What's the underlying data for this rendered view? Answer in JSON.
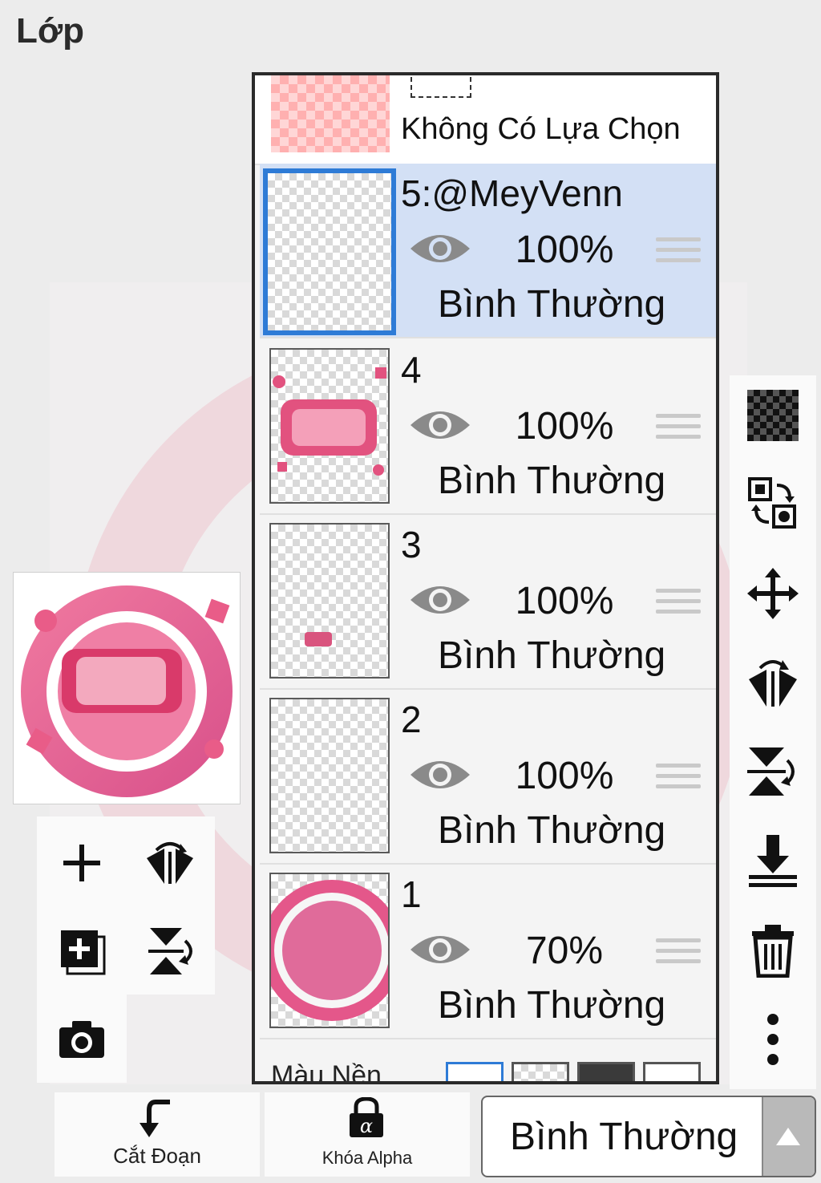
{
  "header": {
    "title": "Lớp"
  },
  "selection_row": {
    "label": "Không Có Lựa Chọn"
  },
  "layers": [
    {
      "name": "5:@MeyVenn",
      "opacity": "100%",
      "blend": "Bình Thường",
      "active": true
    },
    {
      "name": "4",
      "opacity": "100%",
      "blend": "Bình Thường",
      "active": false
    },
    {
      "name": "3",
      "opacity": "100%",
      "blend": "Bình Thường",
      "active": false
    },
    {
      "name": "2",
      "opacity": "100%",
      "blend": "Bình Thường",
      "active": false
    },
    {
      "name": "1",
      "opacity": "70%",
      "blend": "Bình Thường",
      "active": false
    }
  ],
  "background_row": {
    "label": "Màu Nền"
  },
  "left_tools": [
    "add-icon",
    "flip-horizontal-icon",
    "add-layer-icon",
    "flip-vertical-icon",
    "camera-icon"
  ],
  "right_tools": [
    "checker-icon",
    "swap-icon",
    "move-icon",
    "flip-horizontal-icon",
    "flip-vertical-icon",
    "merge-down-icon",
    "trash-icon",
    "more-icon"
  ],
  "bottom": {
    "clip_label": "Cắt Đoạn",
    "alpha_lock_label": "Khóa Alpha",
    "blend_mode_value": "Bình Thường"
  },
  "colors": {
    "active_row": "#d3e0f5",
    "active_border": "#2e7bd6",
    "accent_pink": "#e4578a"
  }
}
